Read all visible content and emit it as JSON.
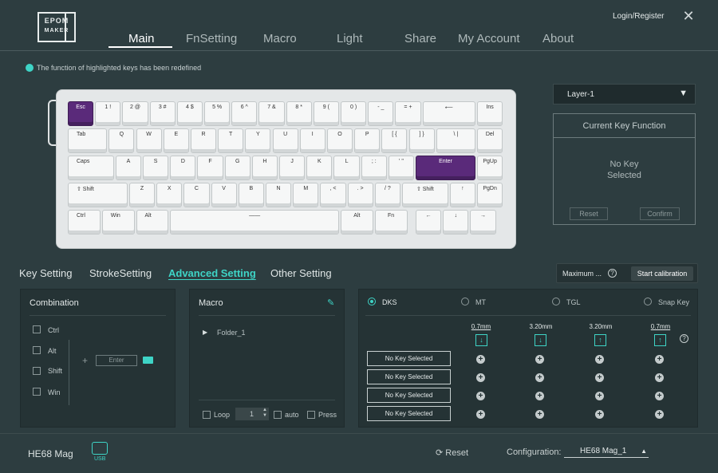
{
  "header": {
    "logo_line1": "EPOM",
    "logo_line2": "MAKER",
    "login": "Login/Register",
    "close": "✕",
    "nav": [
      "Main",
      "FnSetting",
      "Macro",
      "Light",
      "Share",
      "My Account",
      "About"
    ],
    "active_nav": "Main"
  },
  "hint": "The function of highlighted keys has been redefined",
  "keyboard": {
    "row1": [
      "Esc",
      "1 !",
      "2 @",
      "3 #",
      "4 $",
      "5 %",
      "6 ^",
      "7 &",
      "8 *",
      "9 (",
      "0 )",
      "- _",
      "= +",
      "⟵",
      "Ins"
    ],
    "row2": [
      "Tab",
      "Q",
      "W",
      "E",
      "R",
      "T",
      "Y",
      "U",
      "I",
      "O",
      "P",
      "[ {",
      "] }",
      "\\ |",
      "Del"
    ],
    "row3": [
      "Caps",
      "A",
      "S",
      "D",
      "F",
      "G",
      "H",
      "J",
      "K",
      "L",
      "; :",
      "' \"",
      "Enter",
      "PgUp"
    ],
    "row4": [
      "⇧ Shift",
      "Z",
      "X",
      "C",
      "V",
      "B",
      "N",
      "M",
      ", <",
      ". >",
      "/ ?",
      "⇧ Shift",
      "↑",
      "PgDn"
    ],
    "row5": [
      "Ctrl",
      "Win",
      "Alt",
      "——",
      "Alt",
      "Fn",
      "←",
      "↓",
      "→"
    ],
    "highlighted": [
      "Esc",
      "Enter"
    ]
  },
  "layer": {
    "selected": "Layer-1",
    "caret": "▼"
  },
  "current_key": {
    "title": "Current Key Function",
    "line1": "No Key",
    "line2": "Selected",
    "reset": "Reset",
    "confirm": "Confirm"
  },
  "tabs": [
    "Key Setting",
    "StrokeSetting",
    "Advanced Setting",
    "Other Setting"
  ],
  "active_tab": "Advanced Setting",
  "calibration": {
    "label": "Maximum ...",
    "help": "?",
    "button": "Start calibration"
  },
  "combination": {
    "title": "Combination",
    "modifiers": [
      "Ctrl",
      "Alt",
      "Shift",
      "Win"
    ],
    "plus": "+",
    "key_placeholder": "Enter"
  },
  "macro": {
    "title": "Macro",
    "folder": "Folder_1",
    "loop_label": "Loop",
    "loop_value": "1",
    "auto_label": "auto",
    "press_label": "Press"
  },
  "advanced": {
    "modes": [
      "DKS",
      "MT",
      "TGL",
      "Snap Key"
    ],
    "selected_mode": "DKS",
    "columns": [
      "0.7mm",
      "3.20mm",
      "3.20mm",
      "0.7mm"
    ],
    "column_icons": [
      "↓",
      "↓",
      "↑",
      "↑"
    ],
    "help": "?",
    "slots": [
      "No Key Selected",
      "No Key Selected",
      "No Key Selected",
      "No Key Selected"
    ]
  },
  "footer": {
    "model": "HE68 Mag",
    "usb": "USB",
    "reset": "⟳ Reset",
    "config_label": "Configuration:",
    "config_value": "HE68 Mag_1",
    "config_caret": "▲"
  },
  "colors": {
    "accent": "#3ed4c6",
    "highlight_key": "#5a2a7a",
    "background": "#2d3d40"
  }
}
